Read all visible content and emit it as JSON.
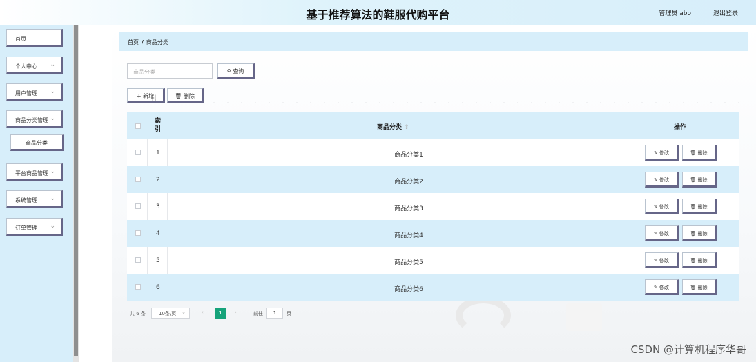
{
  "header": {
    "title": "基于推荐算法的鞋服代购平台",
    "user_label": "管理员 abo",
    "logout_label": "退出登录"
  },
  "sidebar": {
    "items": [
      {
        "label": "首页",
        "has_children": false
      },
      {
        "label": "个人中心",
        "has_children": true
      },
      {
        "label": "用户管理",
        "has_children": true
      },
      {
        "label": "商品分类管理",
        "has_children": true
      },
      {
        "label": "商品分类",
        "submenu": true
      },
      {
        "label": "平台商品管理",
        "has_children": true
      },
      {
        "label": "系统管理",
        "has_children": true
      },
      {
        "label": "订单管理",
        "has_children": true
      }
    ]
  },
  "breadcrumb": {
    "home": "首页",
    "separator": "/",
    "current": "商品分类"
  },
  "search": {
    "placeholder": "商品分类",
    "button_label": "查询",
    "button_icon": "search-icon"
  },
  "toolbar": {
    "add_label": "新增",
    "delete_label": "删除"
  },
  "table": {
    "columns": [
      "索引",
      "商品分类",
      "操作"
    ],
    "sort_icon": "⇕",
    "rows": [
      {
        "index": "1",
        "name": "商品分类1"
      },
      {
        "index": "2",
        "name": "商品分类2"
      },
      {
        "index": "3",
        "name": "商品分类3"
      },
      {
        "index": "4",
        "name": "商品分类4"
      },
      {
        "index": "5",
        "name": "商品分类5"
      },
      {
        "index": "6",
        "name": "商品分类6"
      }
    ],
    "edit_label": "修改",
    "delete_label": "删除"
  },
  "pagination": {
    "total": "共 6 条",
    "page_size": "10条/页",
    "current_page": "1",
    "goto_label": "前往",
    "goto_value": "1",
    "page_suffix": "页"
  },
  "watermark": "CSDN @计算机程序华哥",
  "colors": {
    "accent": "#d7eefa",
    "active_page": "#16a37a",
    "button_border": "#666688"
  }
}
